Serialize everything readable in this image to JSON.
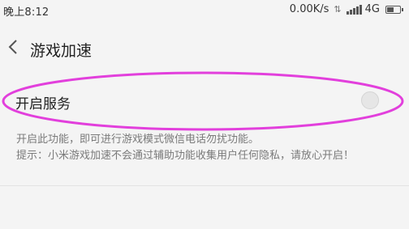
{
  "status_bar": {
    "time": "晚上8:12",
    "net_speed": "0.00K/s",
    "data_arrows": "⇅",
    "net_type": "4G",
    "battery_level": 0.6
  },
  "header": {
    "back_icon": "chevron-left-icon",
    "title": "游戏加速"
  },
  "service": {
    "label": "开启服务",
    "toggle_on": false
  },
  "description": {
    "line1": "开启此功能，即可进行游戏模式微信电话勿扰功能。",
    "line2": "提示：小米游戏加速不会通过辅助功能收集用户任何隐私，请放心开启！"
  },
  "colors": {
    "highlight": "#e23fdc",
    "background": "#f4f4f4",
    "secondary_text": "#7a7a7a"
  }
}
